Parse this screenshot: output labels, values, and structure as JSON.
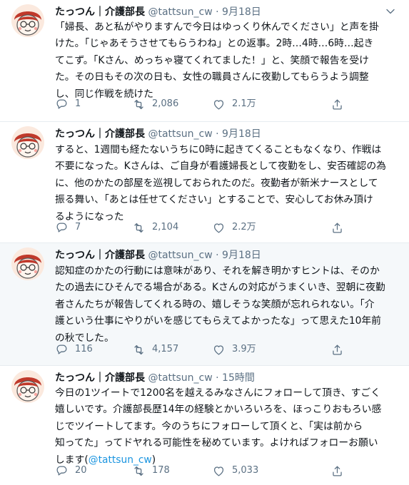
{
  "colors": {
    "text": "#0f1419",
    "secondary": "#5b7083",
    "link": "#1b95e0",
    "divider": "#e6ecf0",
    "highlight_bg": "#f5f8fa"
  },
  "icons": {
    "reply": "reply-icon",
    "retweet": "retweet-icon",
    "like": "heart-icon",
    "share": "share-icon",
    "more": "chevron-down-icon"
  },
  "tweets": [
    {
      "name": "たっつん｜介護部長",
      "handle": "@tattsun_cw",
      "dot": "·",
      "time": "9月18日",
      "lines": [
        "「婦長、あと私がやりますんで今日はゆっくり休んでください」と声を掛",
        "けた。「じゃあそうさせてもらうわね」との返事。2時…4時…6時…起き",
        "てこず。「Kさん、めっちゃ寝てくれてました！」と、笑顔で報告を受け",
        "た。その日もその次の日も、女性の職員さんに夜勤してもらうよう調整",
        "し、同じ作戦を続けた"
      ],
      "replies": "1",
      "retweets": "2,086",
      "likes": "2.1万"
    },
    {
      "name": "たっつん｜介護部長",
      "handle": "@tattsun_cw",
      "dot": "·",
      "time": "9月18日",
      "lines": [
        "すると、1週間も経たないうちに0時に起きてくることもなくなり、作戦は",
        "不要になった。Kさんは、ご自身が看護婦長として夜勤をし、安否確認の為",
        "に、他のかたの部屋を巡視しておられたのだ。夜勤者が新米ナースとして",
        "振る舞い、「あとは任せてください」とすることで、安心してお休み頂け",
        "るようになった"
      ],
      "replies": "7",
      "retweets": "2,104",
      "likes": "2.2万"
    },
    {
      "name": "たっつん｜介護部長",
      "handle": "@tattsun_cw",
      "dot": "·",
      "time": "9月18日",
      "lines": [
        "認知症のかたの行動には意味があり、それを解き明かすヒントは、そのか",
        "たの過去にひそんでる場合がある。Kさんの対応がうまくいき、翌朝に夜勤",
        "者さんたちが報告してくれる時の、嬉しそうな笑顔が忘れられない。「介",
        "護という仕事にやりがいを感じてもらえてよかったな」って思えた10年前",
        "の秋でした。"
      ],
      "replies": "116",
      "retweets": "4,157",
      "likes": "3.9万"
    },
    {
      "name": "たっつん｜介護部長",
      "handle": "@tattsun_cw",
      "dot": "·",
      "time": "15時間",
      "lines": [
        "今日の1ツイートで1200名を越えるみなさんにフォローして頂き、すごく",
        "嬉しいです。介護部長歴14年の経験とかいろいろを、ほっこりおもろい感",
        "じでツイートしてます。今のうちにフォローして頂くと、「実は前から",
        "知ってた」ってドヤれる可能性を秘めています。よければフォローお願い"
      ],
      "last_line_text": "します(",
      "last_line_mention": "@tattsun_cw",
      "last_line_close": ")",
      "replies": "20",
      "retweets": "178",
      "likes": "5,033"
    }
  ]
}
